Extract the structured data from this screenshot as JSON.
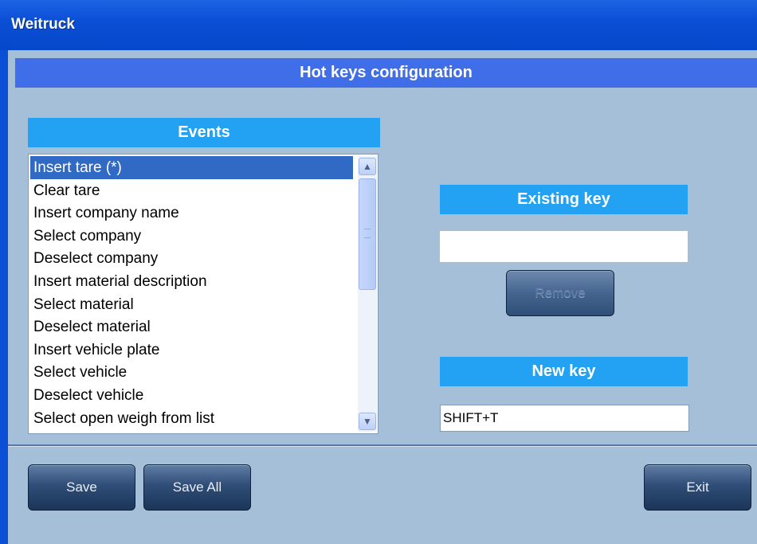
{
  "window": {
    "title": "Weitruck"
  },
  "banner": {
    "title": "Hot keys configuration"
  },
  "events": {
    "header": "Events",
    "items": [
      "Insert tare (*)",
      "Clear tare",
      "Insert company name",
      "Select company",
      "Deselect company",
      "Insert material description",
      "Select material",
      "Deselect material",
      "Insert vehicle plate",
      "Select vehicle",
      "Deselect vehicle",
      "Select open weigh from list"
    ],
    "selected_index": 0
  },
  "existing_key": {
    "header": "Existing key",
    "value": "",
    "remove_label": "Remove"
  },
  "new_key": {
    "header": "New key",
    "value": "SHIFT+T"
  },
  "footer": {
    "save_label": "Save",
    "save_all_label": "Save All",
    "exit_label": "Exit"
  },
  "icons": {
    "scroll_up": "chevron-up-icon",
    "scroll_down": "chevron-down-icon"
  },
  "colors": {
    "titlebar": "#0b4fd6",
    "banner": "#3f6ee8",
    "header": "#23a2f4",
    "background": "#a6bfd8",
    "selection": "#316ac5"
  }
}
